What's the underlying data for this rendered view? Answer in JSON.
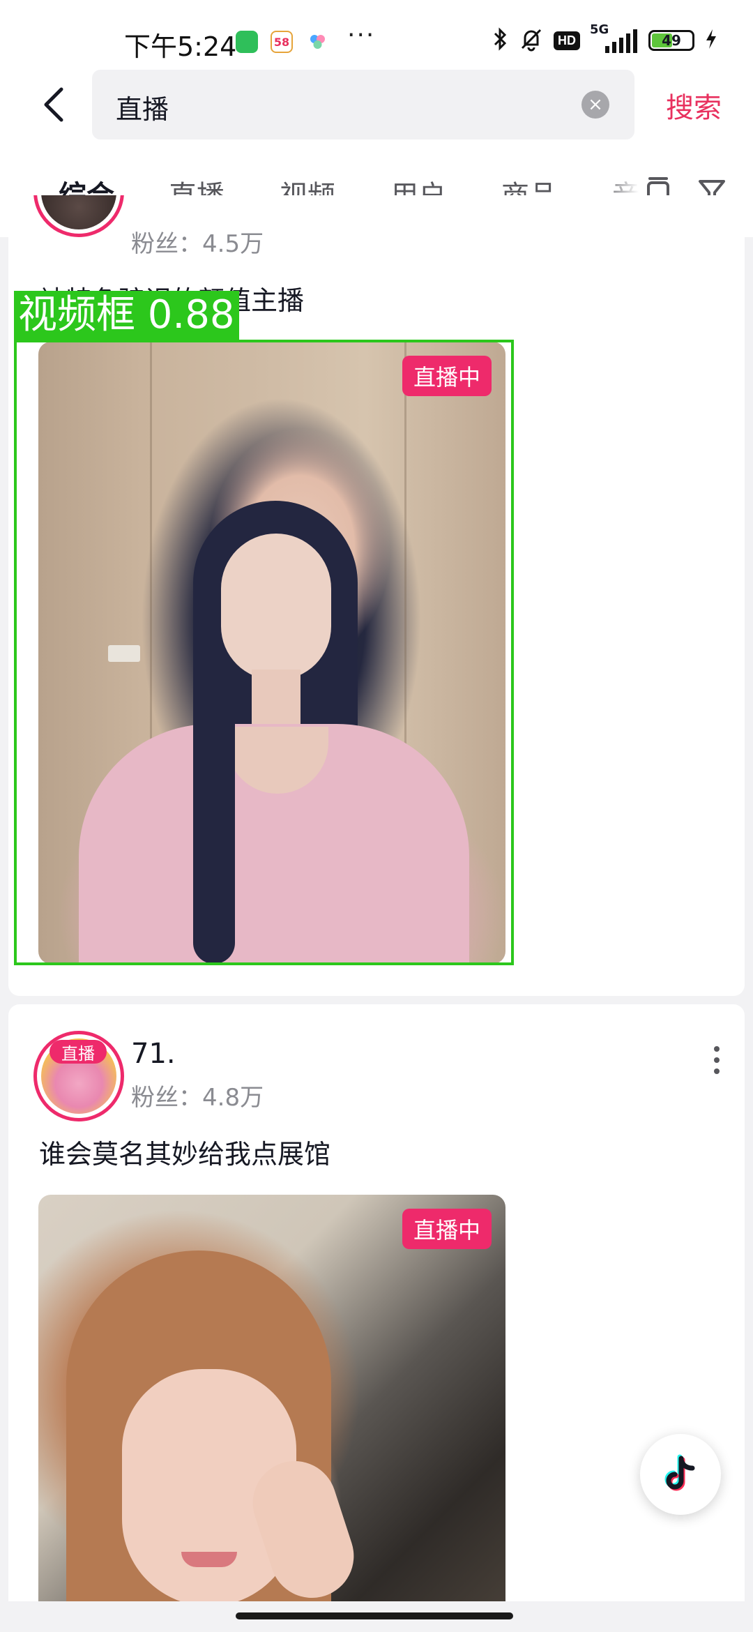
{
  "status_bar": {
    "time": "下午5:24",
    "app_badge_58": "58",
    "dots": "···",
    "hd": "HD",
    "network": "5G",
    "battery": "49",
    "icons": [
      "wechat-icon",
      "58-icon",
      "cloud-icon",
      "bluetooth-icon",
      "bell-off-icon",
      "signal-icon",
      "charging-icon"
    ]
  },
  "search": {
    "query": "直播",
    "clear_symbol": "×",
    "submit_label": "搜索",
    "accent_color": "#e8305e"
  },
  "tabs": [
    {
      "label": "综合",
      "active": true
    },
    {
      "label": "直播",
      "active": false
    },
    {
      "label": "视频",
      "active": false
    },
    {
      "label": "用户",
      "active": false
    },
    {
      "label": "商品",
      "active": false
    },
    {
      "label": "音",
      "active": false
    }
  ],
  "results": [
    {
      "fans": "粉丝：4.5万",
      "description": "被特色骗误的颜值主播",
      "live_tag": "直播中"
    },
    {
      "avatar_badge": "直播",
      "name": "71.",
      "fans": "粉丝：4.8万",
      "description": "谁会莫名其妙给我点展馆",
      "live_tag": "直播中"
    }
  ],
  "detection": {
    "label": "视频框 0.88",
    "color": "#2cc71c"
  },
  "live_color": "#ee2a6b"
}
